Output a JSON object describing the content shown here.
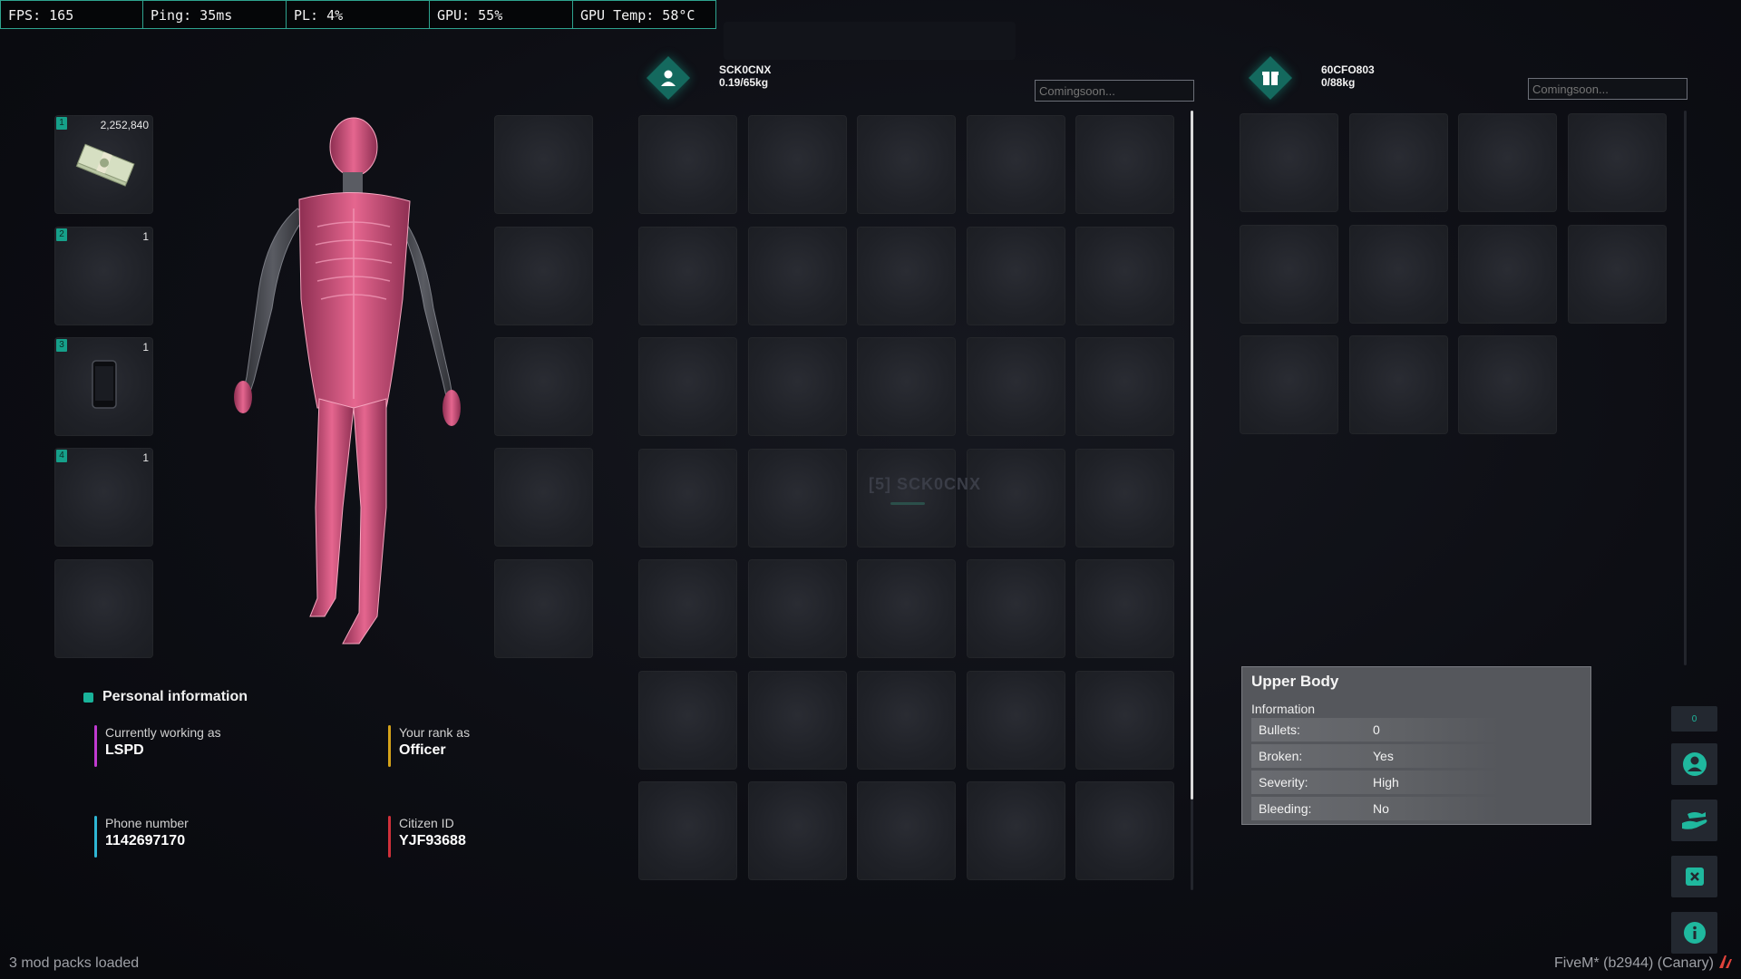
{
  "perf_bar": [
    {
      "label": "FPS: 165"
    },
    {
      "label": "Ping: 35ms"
    },
    {
      "label": "PL: 4%"
    },
    {
      "label": "GPU: 55%"
    },
    {
      "label": "GPU Temp: 58°C"
    }
  ],
  "hotbar": [
    {
      "num": "1",
      "count": "2,252,840",
      "item": "cash-stack"
    },
    {
      "num": "2",
      "count": "1",
      "item": ""
    },
    {
      "num": "3",
      "count": "1",
      "item": "phone"
    },
    {
      "num": "4",
      "count": "1",
      "item": ""
    },
    {
      "num": "",
      "count": "",
      "item": ""
    }
  ],
  "player_inventory": {
    "id": "SCK0CNX",
    "weight": "0.19/65kg",
    "search_placeholder": "Comingsoon..."
  },
  "secondary_inventory": {
    "id": "60CFO803",
    "weight": "0/88kg",
    "search_placeholder": "Comingsoon..."
  },
  "center_watermark": "[5] SCK0CNX",
  "personal_info": {
    "title": "Personal information",
    "job_label": "Currently working as",
    "job_value": "LSPD",
    "rank_label": "Your rank as",
    "rank_value": "Officer",
    "phone_label": "Phone number",
    "phone_value": "1142697170",
    "citizen_label": "Citizen ID",
    "citizen_value": "YJF93688"
  },
  "tooltip": {
    "title": "Upper Body",
    "subtitle": "Information",
    "rows": [
      {
        "key": "Bullets:",
        "value": "0"
      },
      {
        "key": "Broken:",
        "value": "Yes"
      },
      {
        "key": "Severity:",
        "value": "High"
      },
      {
        "key": "Bleeding:",
        "value": "No"
      }
    ]
  },
  "side_buttons": {
    "counter": "0"
  },
  "footer": {
    "mods": "3 mod packs loaded",
    "build": "FiveM* (b2944) (Canary)"
  },
  "colors": {
    "accent": "#19b39a",
    "job_bar": "#c03ad0",
    "rank_bar": "#d4a21a",
    "phone_bar": "#2fb6d4",
    "citizen_bar": "#d0303a"
  }
}
